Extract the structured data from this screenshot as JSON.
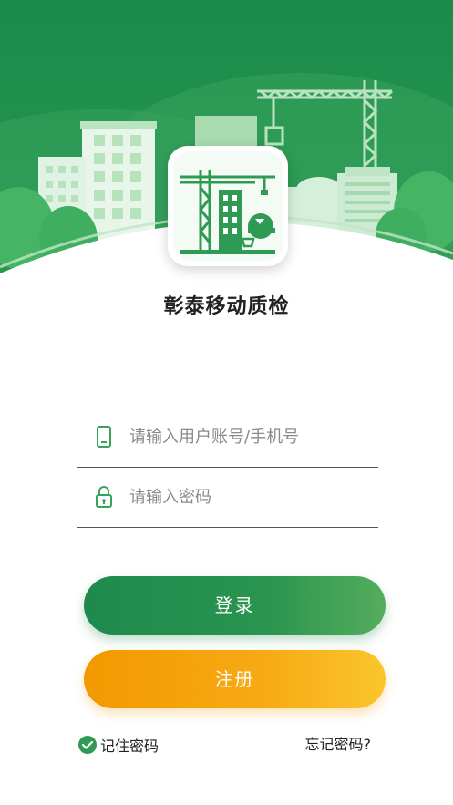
{
  "app": {
    "title": "彰泰移动质检"
  },
  "login_form": {
    "account_placeholder": "请输入用户账号/手机号",
    "account_value": "",
    "password_placeholder": "请输入密码",
    "password_value": ""
  },
  "buttons": {
    "login_label": "登录",
    "register_label": "注册"
  },
  "options": {
    "remember_label": "记住密码",
    "remember_checked": true,
    "forgot_label": "忘记密码?"
  },
  "icons": {
    "account": "phone-icon",
    "password": "lock-icon",
    "remember": "check-circle-icon",
    "logo": "construction-crane-logo"
  },
  "colors": {
    "primary_green": "#2a9450",
    "hero_green": "#1e8a4c",
    "accent_orange": "#f7aa14"
  }
}
